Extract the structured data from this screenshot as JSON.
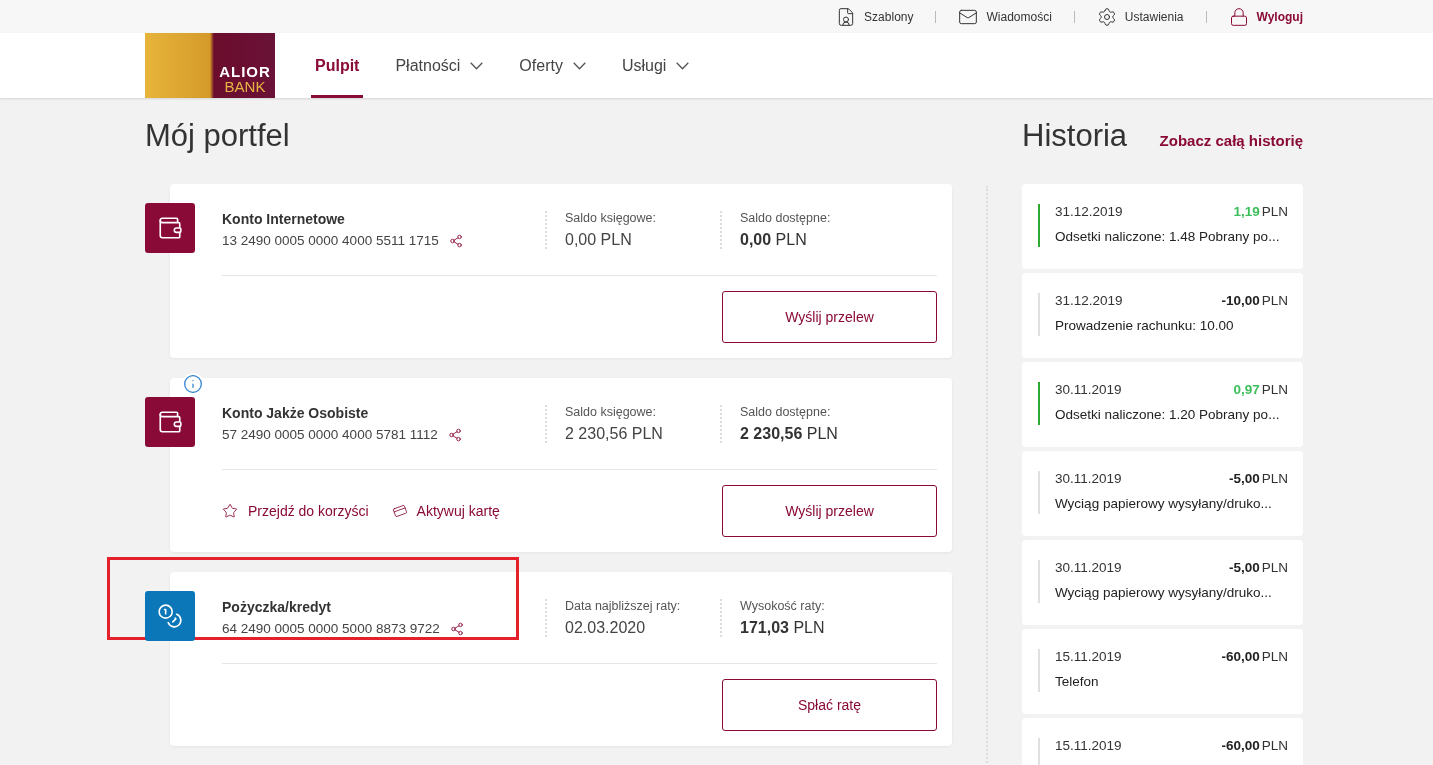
{
  "top_bar": {
    "links": [
      {
        "kind": "templates",
        "label": "Szablony"
      },
      {
        "kind": "messages",
        "label": "Wiadomości"
      },
      {
        "kind": "settings",
        "label": "Ustawienia"
      },
      {
        "kind": "logout",
        "label": "Wyloguj"
      }
    ]
  },
  "logo": {
    "line1": "ALIOR",
    "line2": "BANK"
  },
  "nav": [
    {
      "label": "Pulpit",
      "selected": true,
      "dropdown": false
    },
    {
      "label": "Płatności",
      "selected": false,
      "dropdown": true
    },
    {
      "label": "Oferty",
      "selected": false,
      "dropdown": true
    },
    {
      "label": "Usługi",
      "selected": false,
      "dropdown": true
    }
  ],
  "portfolio": {
    "title": "Mój portfel",
    "accounts": [
      {
        "kind": "account",
        "name": "Konto Internetowe",
        "number": "13 2490 0005 0000 4000 5511 1715",
        "info": false,
        "highlighted": false,
        "fields": [
          {
            "label": "Saldo księgowe:",
            "value": "0,00 PLN",
            "bold": false
          },
          {
            "label": "Saldo dostępne:",
            "value": "**0,00** PLN",
            "bold": true
          }
        ],
        "button": "Wyślij przelew"
      },
      {
        "kind": "account",
        "name": "Konto Jakże Osobiste",
        "number": "57 2490 0005 0000 4000 5781 1112",
        "info": true,
        "highlighted": false,
        "fields": [
          {
            "label": "Saldo księgowe:",
            "value": "2 230,56 PLN",
            "bold": false
          },
          {
            "label": "Saldo dostępne:",
            "value": "**2 230,56** PLN",
            "bold": true
          }
        ],
        "links": [
          {
            "kind": "benefits",
            "label": "Przejdź do korzyści"
          },
          {
            "kind": "card",
            "label": "Aktywuj kartę"
          }
        ],
        "button": "Wyślij przelew"
      },
      {
        "kind": "loan",
        "name": "Pożyczka/kredyt",
        "number": "64 2490 0005 0000 5000 8873 9722",
        "info": false,
        "highlighted": true,
        "fields": [
          {
            "label": "Data najbliższej raty:",
            "value": "02.03.2020",
            "bold": false
          },
          {
            "label": "Wysokość raty:",
            "value": "**171,03** PLN",
            "bold": true
          }
        ],
        "button": "Spłać ratę"
      }
    ]
  },
  "history": {
    "title": "Historia",
    "link": "Zobacz całą historię",
    "items": [
      {
        "kind": "credit",
        "date": "31.12.2019",
        "amount": "1,19",
        "currency": "PLN",
        "description": "Odsetki naliczone: 1.48 Pobrany po..."
      },
      {
        "kind": "debit",
        "date": "31.12.2019",
        "amount": "-10,00",
        "currency": "PLN",
        "description": "Prowadzenie rachunku: 10.00"
      },
      {
        "kind": "credit",
        "date": "30.11.2019",
        "amount": "0,97",
        "currency": "PLN",
        "description": "Odsetki naliczone: 1.20 Pobrany po..."
      },
      {
        "kind": "debit",
        "date": "30.11.2019",
        "amount": "-5,00",
        "currency": "PLN",
        "description": "Wyciąg papierowy wysyłany/druko..."
      },
      {
        "kind": "debit",
        "date": "30.11.2019",
        "amount": "-5,00",
        "currency": "PLN",
        "description": "Wyciąg papierowy wysyłany/druko..."
      },
      {
        "kind": "debit",
        "date": "15.11.2019",
        "amount": "-60,00",
        "currency": "PLN",
        "description": "Telefon"
      },
      {
        "kind": "debit",
        "date": "15.11.2019",
        "amount": "-60,00",
        "currency": "PLN"
      }
    ]
  }
}
